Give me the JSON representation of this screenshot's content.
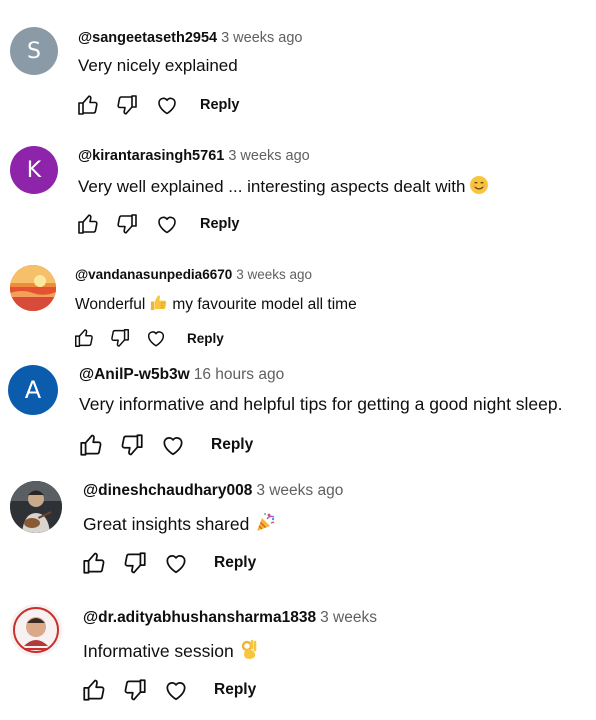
{
  "comments": [
    {
      "handle": "@sangeetaseth2954",
      "time": "3 weeks ago",
      "text": "Very nicely explained",
      "avatar_letter": "S",
      "avatar_color": "#8a9aa6",
      "reply_label": "Reply"
    },
    {
      "handle": "@kirantarasingh5761",
      "time": "3 weeks ago",
      "text": "Very well explained ... interesting aspects dealt with",
      "avatar_letter": "K",
      "avatar_color": "#8e24aa",
      "reply_label": "Reply",
      "emoji": "smiling-face"
    },
    {
      "handle": "@vandanasunpedia6670",
      "time": "3 weeks ago",
      "text_before": "Wonderful",
      "text_after": "my favourite model all time",
      "avatar_letter": "",
      "avatar_color": "#e8643a",
      "reply_label": "Reply",
      "emoji": "thumbs-up"
    },
    {
      "handle": "@AnilP-w5b3w",
      "time": "16 hours ago",
      "text": "Very informative and helpful tips for getting a good night sleep.",
      "avatar_letter": "A",
      "avatar_color": "#0b5cad",
      "reply_label": "Reply"
    },
    {
      "handle": "@dineshchaudhary008",
      "time": "3 weeks ago",
      "text": "Great insights shared",
      "avatar_letter": "",
      "avatar_color": "#3b3f44",
      "reply_label": "Reply",
      "emoji": "party-popper"
    },
    {
      "handle": "@dr.adityabhushansharma1838",
      "time": "3 weeks",
      "text": "Informative session",
      "avatar_letter": "",
      "avatar_color": "#f4eeee",
      "reply_label": "Reply",
      "emoji": "ok-hand"
    }
  ],
  "colors": {
    "text": "#0f0f0f",
    "secondary": "#606060"
  }
}
